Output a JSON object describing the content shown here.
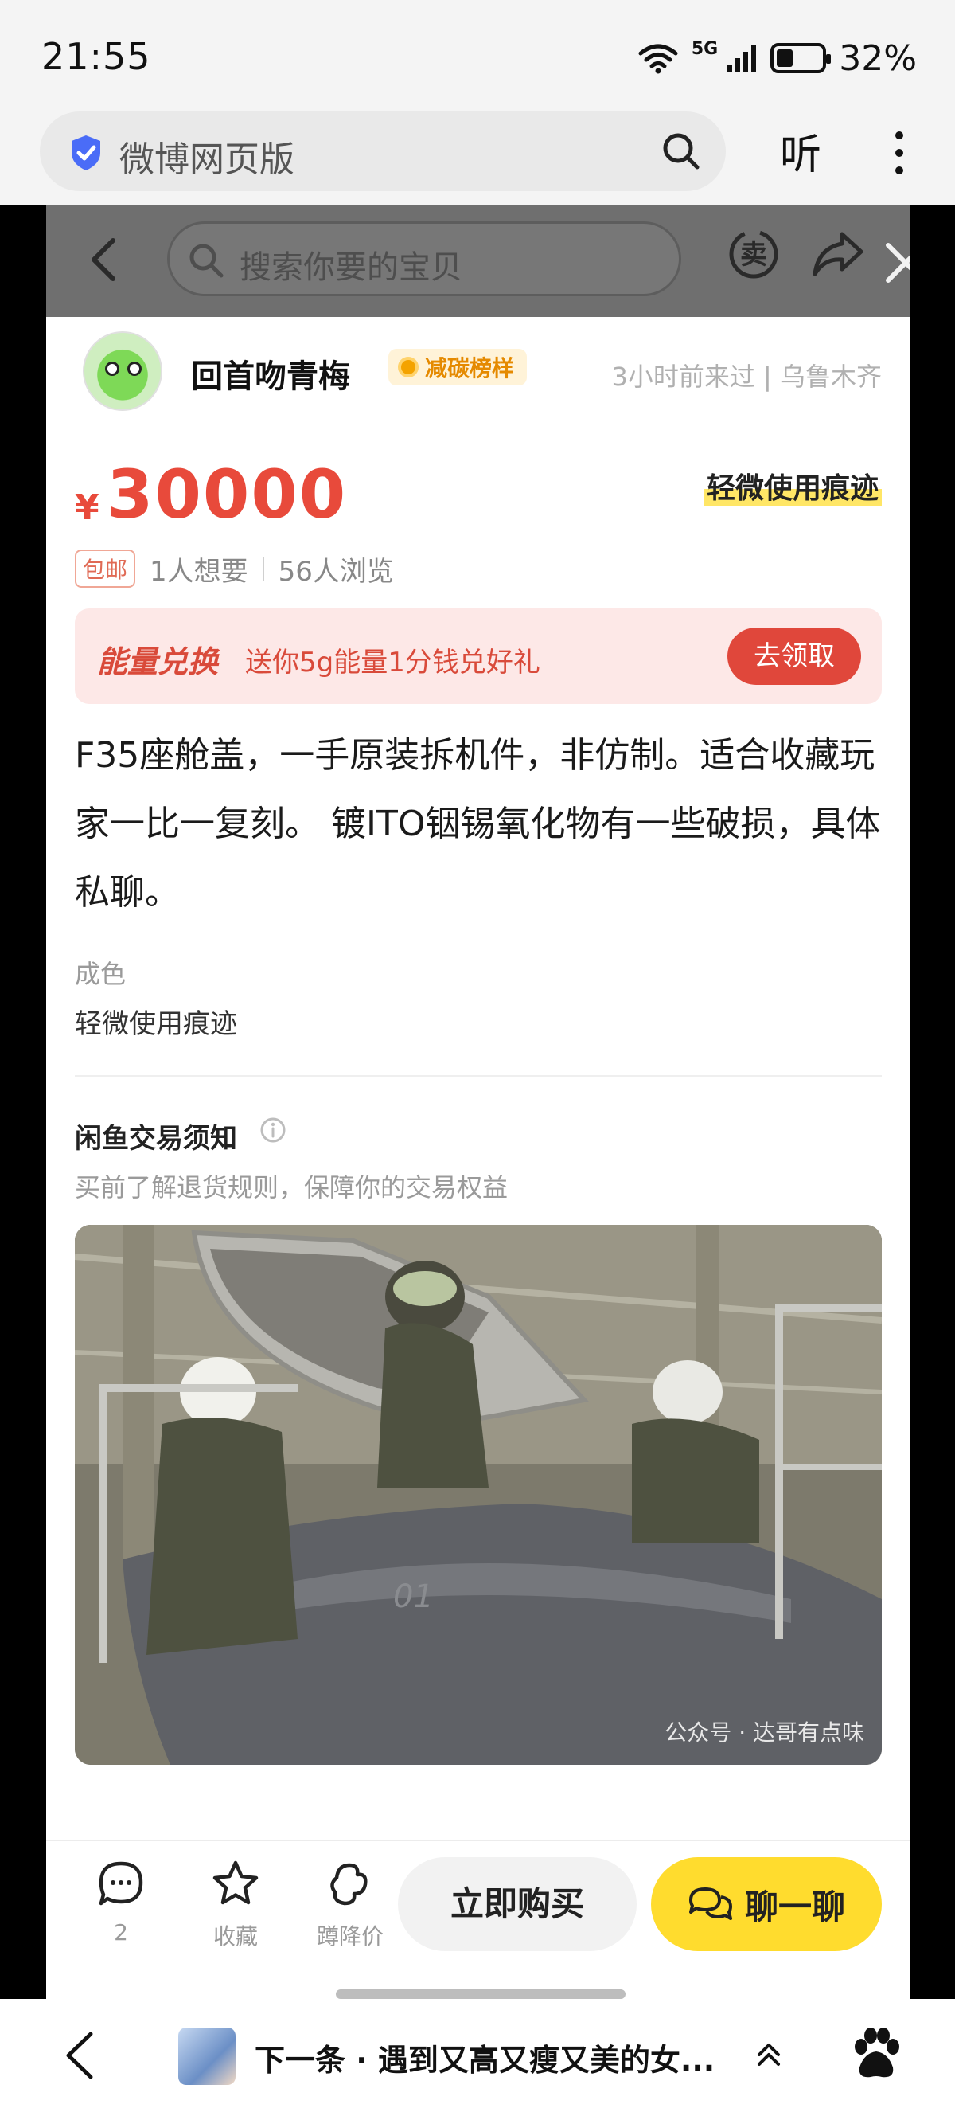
{
  "status_bar": {
    "time": "21:55",
    "network": "5G",
    "battery": "32%"
  },
  "browser": {
    "address": "微博网页版",
    "listen_label": "听"
  },
  "listing": {
    "search_placeholder": "搜索你要的宝贝",
    "sell_label": "卖",
    "seller": {
      "name": "回首吻青梅",
      "badge": "减碳榜样",
      "meta": "3小时前来过 | 乌鲁木齐"
    },
    "currency": "¥",
    "price": "30000",
    "condition_tag": "轻微使用痕迹",
    "free_shipping": "包邮",
    "wants": "1人想要",
    "views": "56人浏览",
    "energy": {
      "title": "能量兑换",
      "desc": "送你5g能量1分钱兑好礼",
      "button": "去领取"
    },
    "description": "F35座舱盖，一手原装拆机件，非仿制。适合收藏玩家一比一复刻。 镀ITO铟锡氧化物有一些破损，具体私聊。",
    "condition_label": "成色",
    "condition_value": "轻微使用痕迹",
    "notice_title": "闲鱼交易须知",
    "notice_sub": "买前了解退货规则，保障你的交易权益",
    "photo_watermark": "公众号 · 达哥有点味",
    "bottom": {
      "comments_count": "2",
      "favorite": "收藏",
      "price_drop": "蹲降价",
      "buy_now": "立即购买",
      "chat": "聊一聊"
    }
  },
  "browser_bottom": {
    "next_title": "下一条 · 遇到又高又瘦又美的女..."
  },
  "colors": {
    "price_red": "#e84a3b",
    "chat_yellow": "#ffdc2e",
    "energy_bg": "#fde8e7",
    "badge_orange": "#e58a00"
  }
}
